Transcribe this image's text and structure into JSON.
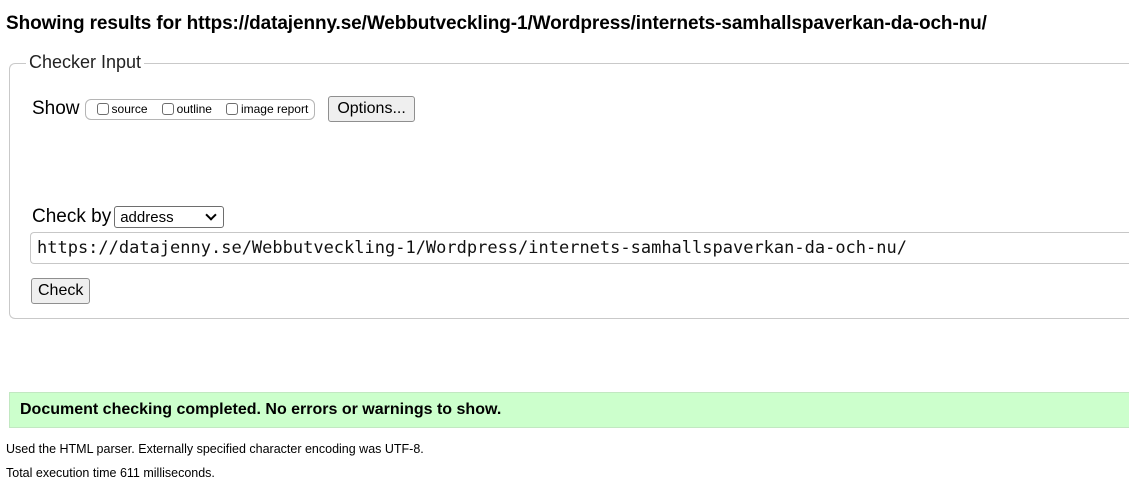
{
  "heading": "Showing results for https://datajenny.se/Webbutveckling-1/Wordpress/internets-samhallspaverkan-da-och-nu/",
  "checker_input": {
    "legend": "Checker Input",
    "show_label": "Show",
    "show_options": [
      {
        "label": "source",
        "checked": false
      },
      {
        "label": "outline",
        "checked": false
      },
      {
        "label": "image report",
        "checked": false
      }
    ],
    "options_button": "Options...",
    "check_by_label": "Check by",
    "check_by_selected": "address",
    "url_value": "https://datajenny.se/Webbutveckling-1/Wordpress/internets-samhallspaverkan-da-och-nu/",
    "check_button": "Check"
  },
  "result": {
    "message": "Document checking completed. No errors or warnings to show.",
    "color": "#ccffcc"
  },
  "details": {
    "parser_line": "Used the HTML parser. Externally specified character encoding was UTF-8.",
    "time_line": "Total execution time 611 milliseconds."
  },
  "icons": {
    "select_arrow": "chevron-down-icon"
  }
}
